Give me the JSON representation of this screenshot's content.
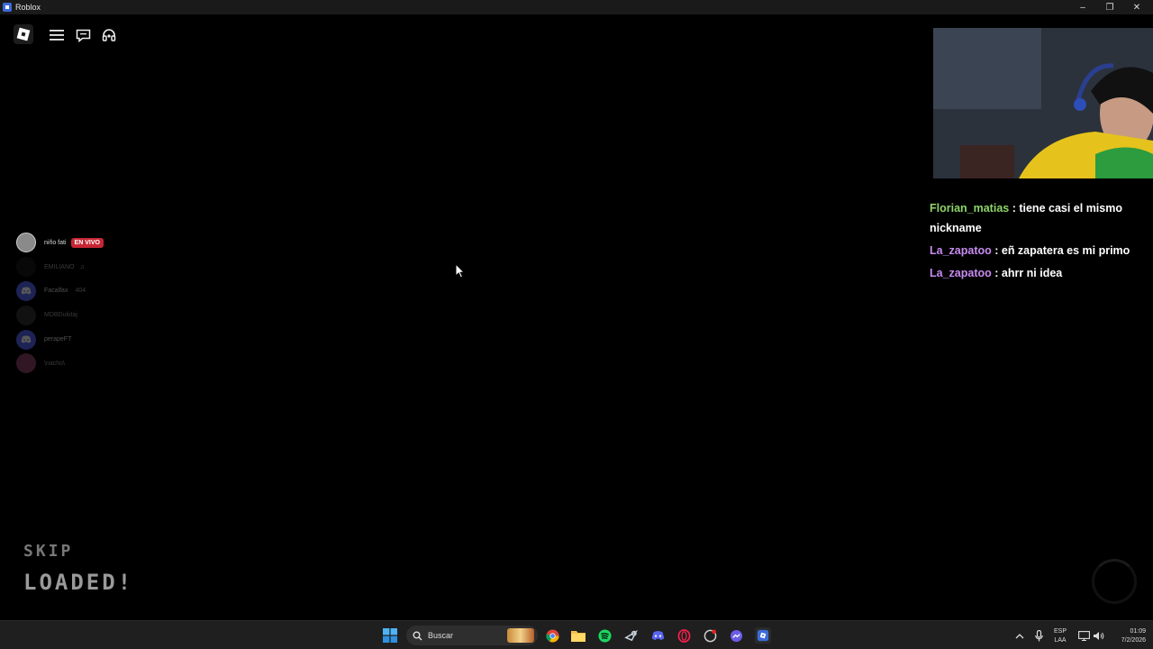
{
  "window": {
    "title": "Roblox"
  },
  "topbar": {
    "buttons": [
      {
        "name": "menu-button",
        "icon": "hamburger-icon"
      },
      {
        "name": "chat-button",
        "icon": "chat-icon"
      },
      {
        "name": "headset-button",
        "icon": "headset-icon"
      }
    ]
  },
  "voice": {
    "users": [
      {
        "name": "niño fati",
        "badge": "EN VIVO",
        "dim": false
      },
      {
        "name": "EMILIANO",
        "badge": "",
        "dim": true
      },
      {
        "name": "Facalfax",
        "badge": "404",
        "dim": true
      },
      {
        "name": "MDBDukitaj",
        "badge": "",
        "dim": true
      },
      {
        "name": "perapeFT",
        "badge": "",
        "dim": true
      },
      {
        "name": "\\nacho\\",
        "badge": "",
        "dim": true
      }
    ]
  },
  "chat": {
    "messages": [
      {
        "user": "Florian_matias",
        "user_color": "#8fd46a",
        "text": "tiene casi el mismo nickname"
      },
      {
        "user": "La_zapatoo",
        "user_color": "#c88bf0",
        "text": "eñ zapatera es mi primo"
      },
      {
        "user": "La_zapatoo",
        "user_color": "#c88bf0",
        "text": "ahrr ni idea"
      }
    ]
  },
  "loading": {
    "skip": "SKIP",
    "status": "LOADED!"
  },
  "taskbar": {
    "search_placeholder": "Buscar",
    "lang_top": "ESP",
    "lang_bottom": "LAA",
    "time": "01:09",
    "date": "7/2/2026"
  },
  "colors": {
    "live": "#c72634",
    "taskbar": "#1f1f1f",
    "accent": "#3d6bd8"
  }
}
